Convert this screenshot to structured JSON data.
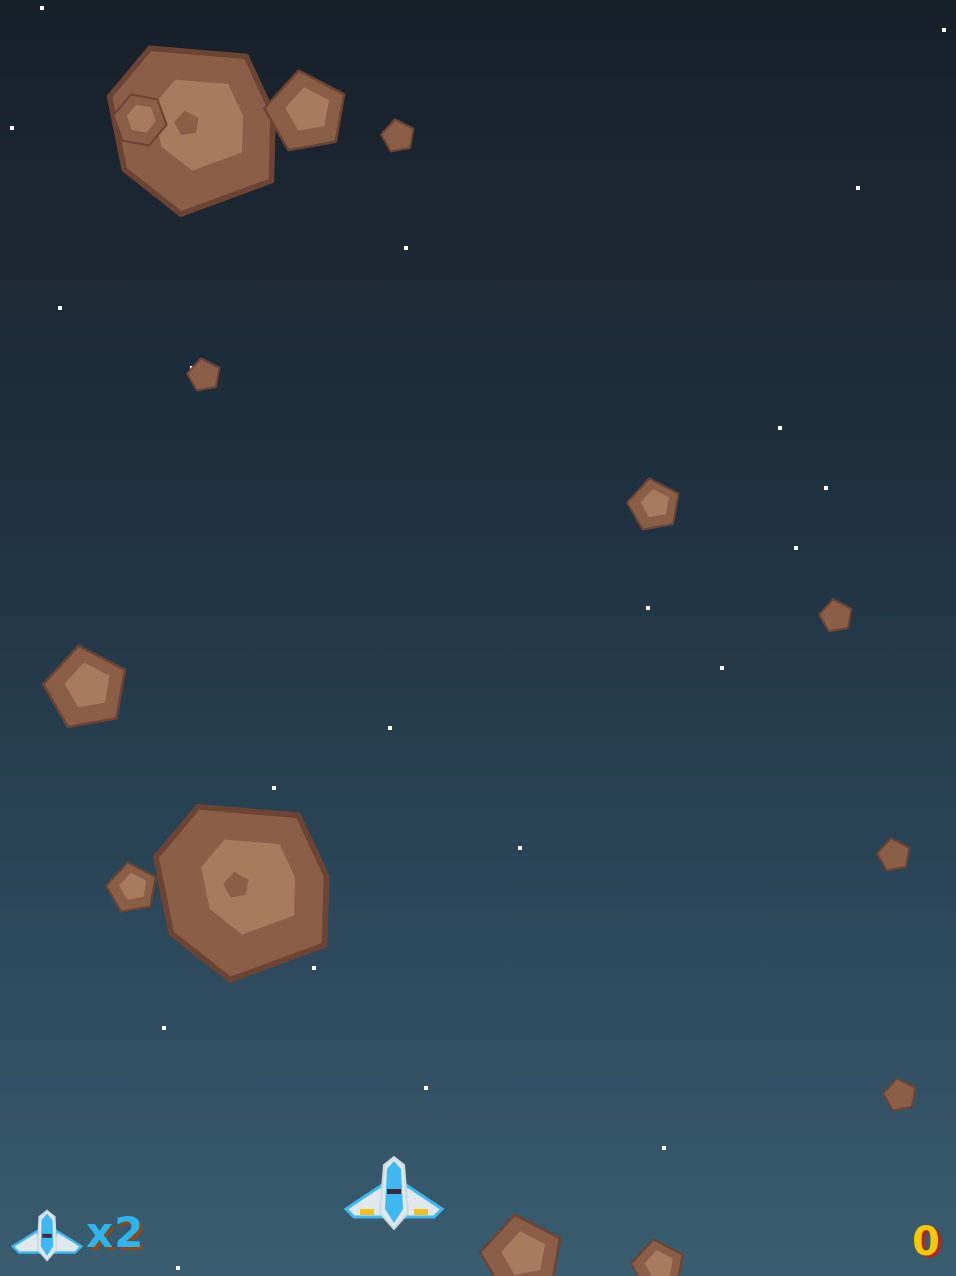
{
  "hud": {
    "lives_label": "x2",
    "score": "0"
  },
  "colors": {
    "asteroid_fill": "#8a5e47",
    "asteroid_highlight": "#a87a5e",
    "asteroid_outline": "#6b4433",
    "star": "#ffffff",
    "ship_body": "#dfe8ee",
    "ship_cockpit": "#3fb8f2",
    "ship_engine": "#f2c21a",
    "lives_text": "#2eb5f0",
    "score_text": "#f5c800"
  },
  "objects": {
    "player_ship": "player-ship-icon",
    "lives_icon": "lives-ship-icon",
    "asteroid_count": 18,
    "star_count": 20
  }
}
